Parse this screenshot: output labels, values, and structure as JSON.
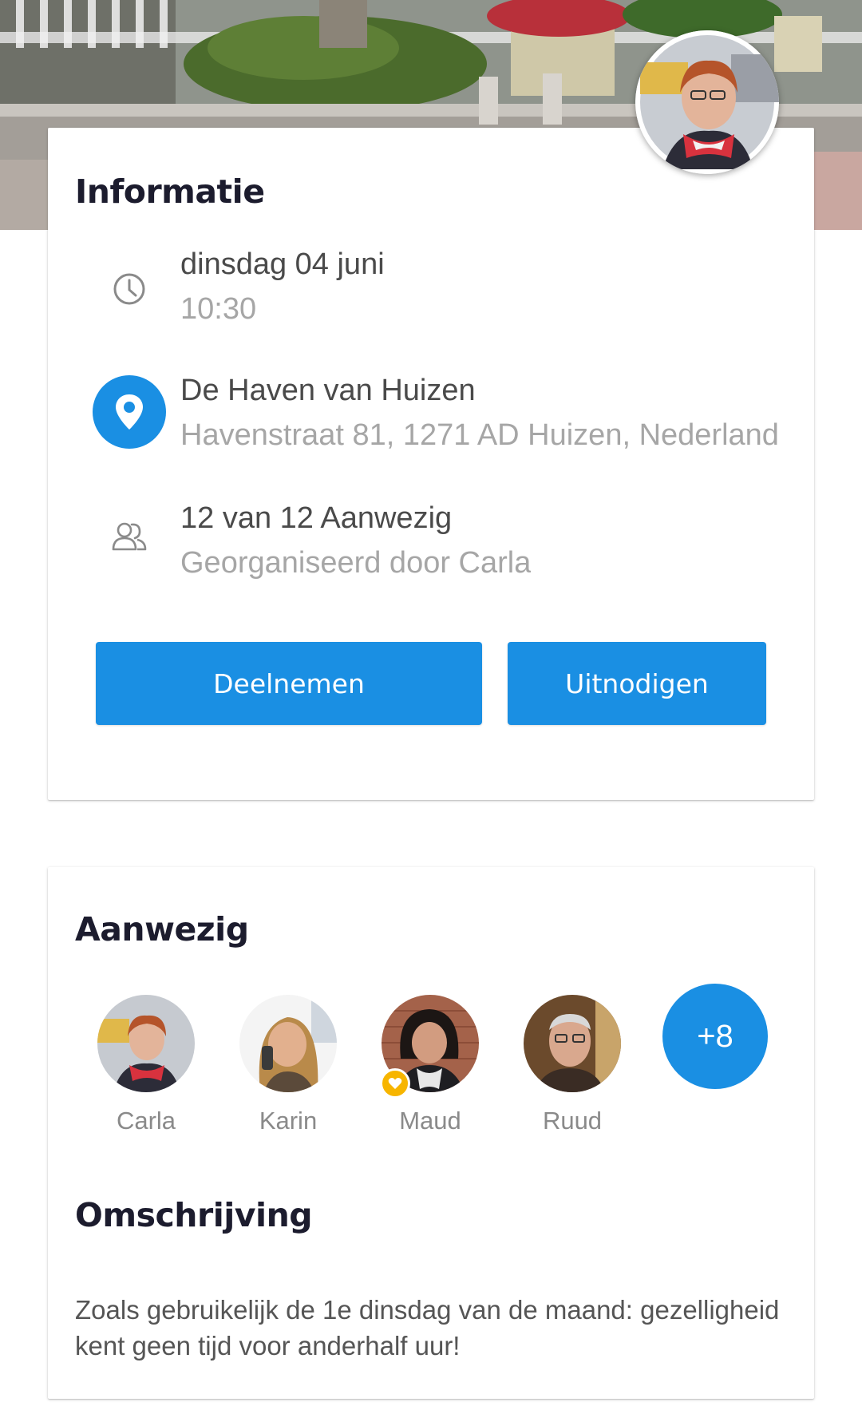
{
  "hero": {
    "image_icon": "street-photo"
  },
  "organizer_avatar_icon": "organizer-avatar",
  "info": {
    "title": "Informatie",
    "date": {
      "icon": "clock-icon",
      "primary": "dinsdag 04 juni",
      "secondary": "10:30"
    },
    "location": {
      "icon": "location-pin-icon",
      "primary": "De Haven van Huizen",
      "secondary": "Havenstraat 81, 1271 AD Huizen, Nederland"
    },
    "attendance": {
      "icon": "people-icon",
      "primary": "12 van 12 Aanwezig",
      "secondary": "Georganiseerd door Carla"
    },
    "buttons": {
      "join": "Deelnemen",
      "invite": "Uitnodigen"
    }
  },
  "attend": {
    "title": "Aanwezig",
    "people": [
      {
        "name": "Carla"
      },
      {
        "name": "Karin"
      },
      {
        "name": "Maud",
        "badge_icon": "heart-badge-icon"
      },
      {
        "name": "Ruud"
      }
    ],
    "more_label": "+8"
  },
  "description": {
    "title": "Omschrijving",
    "text": "Zoals gebruikelijk de 1e dinsdag van de maand: gezelligheid kent geen tijd voor anderhalf uur!"
  },
  "colors": {
    "accent": "#1a8fe3",
    "title": "#1c1c2e",
    "primary_text": "#4a4a4a",
    "secondary_text": "#a6a6a6",
    "badge": "#f7b500"
  }
}
